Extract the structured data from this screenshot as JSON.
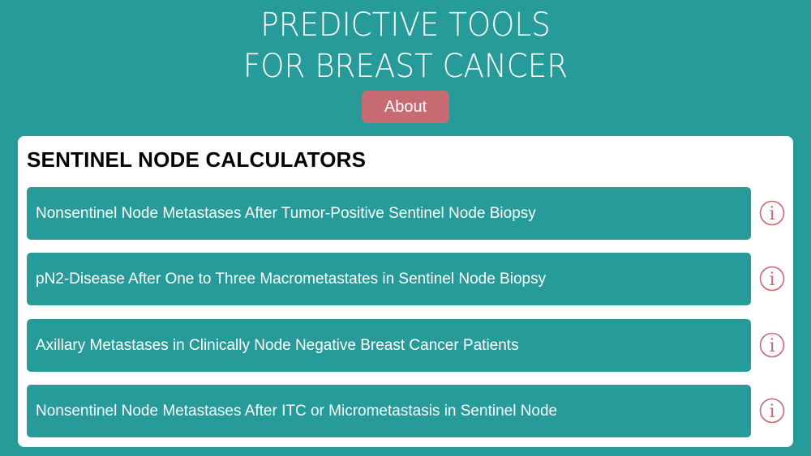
{
  "header": {
    "title_line1": "PREDICTIVE TOOLS",
    "title_line2": "FOR BREAST CANCER",
    "about_label": "About"
  },
  "section": {
    "heading": "SENTINEL NODE CALCULATORS",
    "items": [
      {
        "label": "Nonsentinel Node Metastases After Tumor-Positive Sentinel Node Biopsy",
        "info_icon": "info-icon"
      },
      {
        "label": "pN2-Disease After One to Three Macrometastates in Sentinel Node Biopsy",
        "info_icon": "info-icon"
      },
      {
        "label": "Axillary Metastases in Clinically Node Negative Breast Cancer Patients",
        "info_icon": "info-icon"
      },
      {
        "label": "Nonsentinel Node Metastases After ITC or Micrometastasis in Sentinel Node",
        "info_icon": "info-icon"
      }
    ]
  },
  "colors": {
    "background": "#279b9a",
    "accent": "#c76b73",
    "panel": "#ffffff"
  }
}
